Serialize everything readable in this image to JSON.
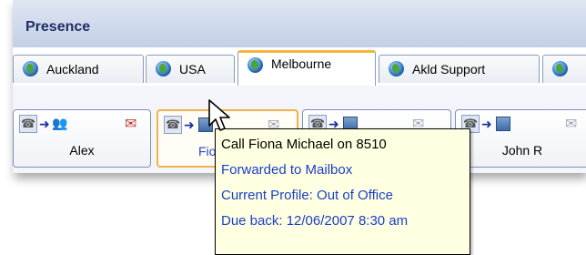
{
  "window": {
    "title": "Presence"
  },
  "tabs": [
    {
      "label": "Auckland"
    },
    {
      "label": "USA"
    },
    {
      "label": "Melbourne",
      "active": true
    },
    {
      "label": "Akld Support"
    },
    {
      "label": ""
    }
  ],
  "cards": [
    {
      "name": "Alex",
      "icon": "people-icon"
    },
    {
      "name": "Fio",
      "icon": "building-icon",
      "hover": true
    },
    {
      "name": "",
      "icon": "building-icon"
    },
    {
      "name": "John R",
      "icon": "building-icon"
    }
  ],
  "tooltip": {
    "call": "Call Fiona Michael on 8510",
    "forwarded": "Forwarded to Mailbox",
    "profile": "Current Profile: Out of Office",
    "due": "Due back: 12/06/2007 8:30 am"
  },
  "colors": {
    "accent_tab": "#f4b43c",
    "tooltip_bg": "#ffffe1",
    "link_blue": "#1b3fc9"
  }
}
